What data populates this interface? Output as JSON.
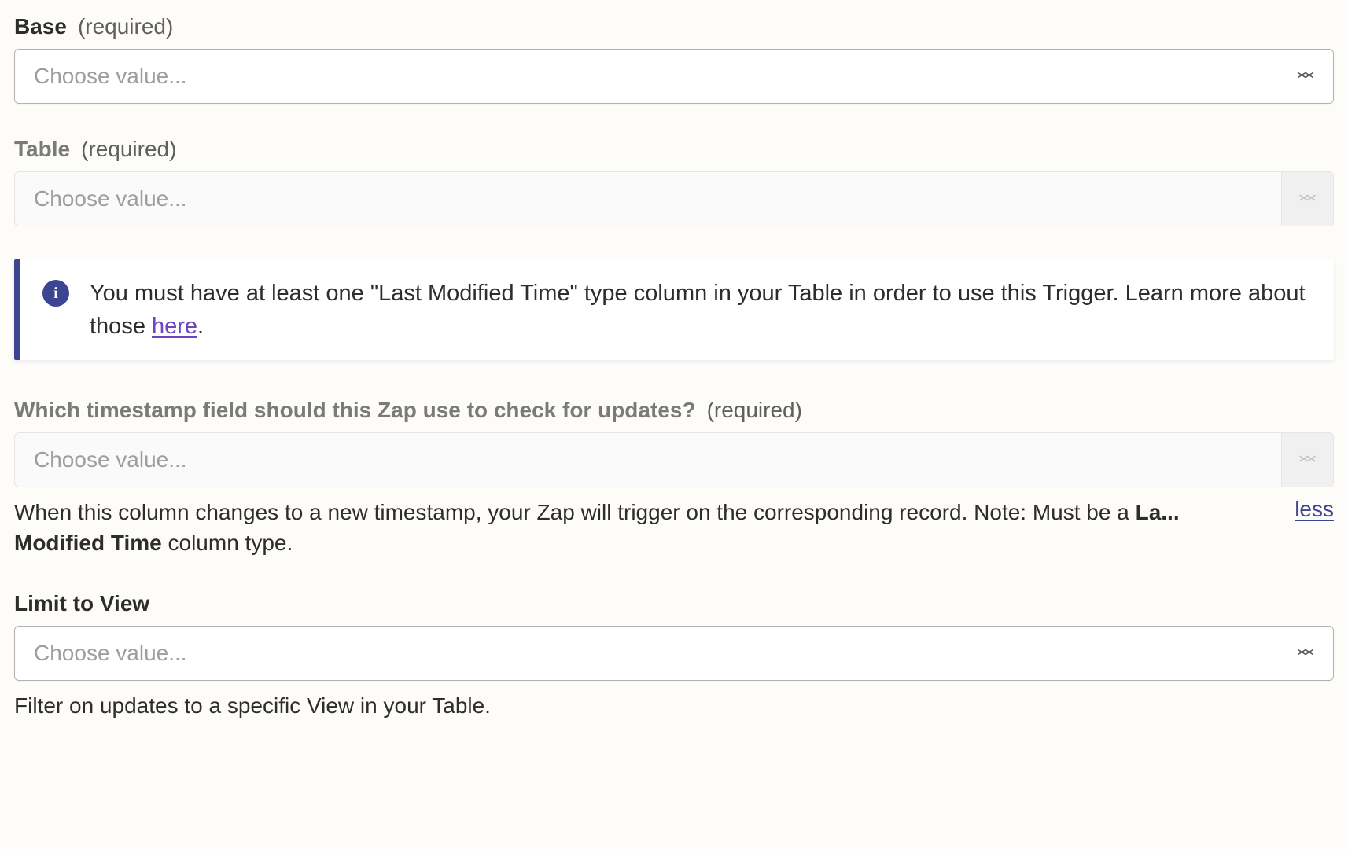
{
  "fields": {
    "base": {
      "label": "Base",
      "required_label": "(required)",
      "placeholder": "Choose value..."
    },
    "table": {
      "label": "Table",
      "required_label": "(required)",
      "placeholder": "Choose value..."
    },
    "timestamp": {
      "label": "Which timestamp field should this Zap use to check for updates?",
      "required_label": "(required)",
      "placeholder": "Choose value...",
      "helper_part1": "When this column changes to a new timestamp, your Zap will trigger on the corresponding record. Note: Must be a ",
      "helper_bold1": "La...",
      "helper_bold2": "Modified Time",
      "helper_part2": " column type.",
      "less_label": "less"
    },
    "limit_view": {
      "label": "Limit to View",
      "placeholder": "Choose value...",
      "helper": "Filter on updates to a specific View in your Table."
    }
  },
  "info": {
    "text_part1": "You must have at least one \"Last Modified Time\" type column in your Table in order to use this Trigger. Learn more about those ",
    "link_text": "here",
    "text_part2": "."
  }
}
